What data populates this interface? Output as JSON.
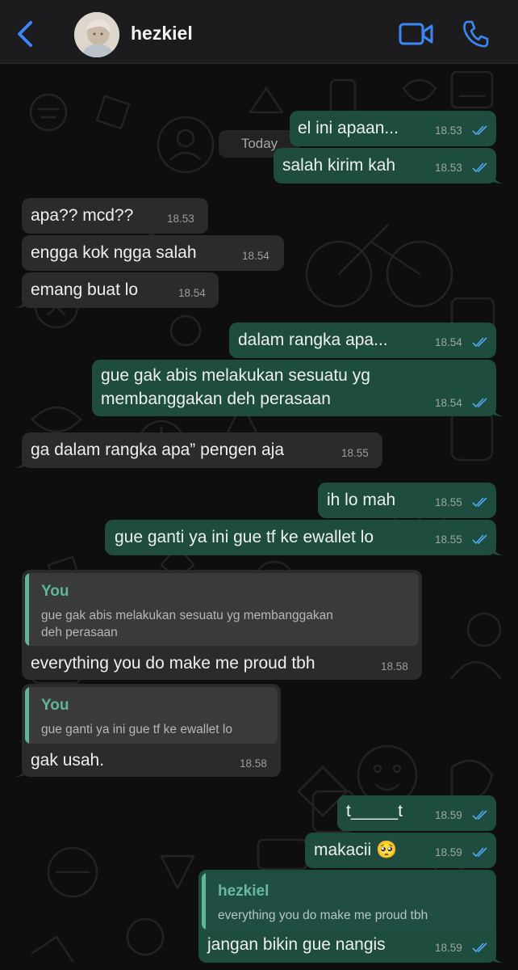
{
  "contact": {
    "name": "hezkiel"
  },
  "colors": {
    "outgoing": "#1e4d40",
    "incoming": "#2b2b2d",
    "accent": "#3b87f5",
    "quote_name": "#5fb59a"
  },
  "day_label": "Today",
  "messages": [
    {
      "dir": "out",
      "text": "el ini apaan...",
      "time": "18.53",
      "status": "read"
    },
    {
      "dir": "out",
      "text": "salah kirim kah",
      "time": "18.53",
      "status": "read"
    },
    {
      "dir": "in",
      "text": "apa?? mcd??",
      "time": "18.53"
    },
    {
      "dir": "in",
      "text": "engga kok ngga salah",
      "time": "18.54"
    },
    {
      "dir": "in",
      "text": "emang buat lo",
      "time": "18.54"
    },
    {
      "dir": "out",
      "text": "dalam rangka apa...",
      "time": "18.54",
      "status": "read"
    },
    {
      "dir": "out",
      "text_line1": "gue gak abis melakukan sesuatu yg",
      "text_line2": "membanggakan deh perasaan",
      "time": "18.54",
      "status": "read"
    },
    {
      "dir": "in",
      "text": "ga dalam rangka apa” pengen aja",
      "time": "18.55"
    },
    {
      "dir": "out",
      "text": "ih lo mah",
      "time": "18.55",
      "status": "read"
    },
    {
      "dir": "out",
      "text": "gue ganti ya ini gue tf ke ewallet lo",
      "time": "18.55",
      "status": "read"
    },
    {
      "dir": "in",
      "quote_name": "You",
      "quote_line1": "gue gak abis melakukan sesuatu yg membanggakan",
      "quote_line2": "deh perasaan",
      "text": "everything you do make me proud tbh",
      "time": "18.58"
    },
    {
      "dir": "in",
      "quote_name": "You",
      "quote_text": "gue ganti ya ini gue tf ke ewallet lo",
      "text": "gak usah.",
      "time": "18.58"
    },
    {
      "dir": "out",
      "text": "t_____t",
      "time": "18.59",
      "status": "read"
    },
    {
      "dir": "out",
      "text": "makacii 🥺",
      "time": "18.59",
      "status": "read"
    },
    {
      "dir": "out",
      "quote_name": "hezkiel",
      "quote_text": "everything you do make me proud tbh",
      "text": "jangan bikin gue nangis",
      "time": "18.59",
      "status": "read"
    }
  ]
}
